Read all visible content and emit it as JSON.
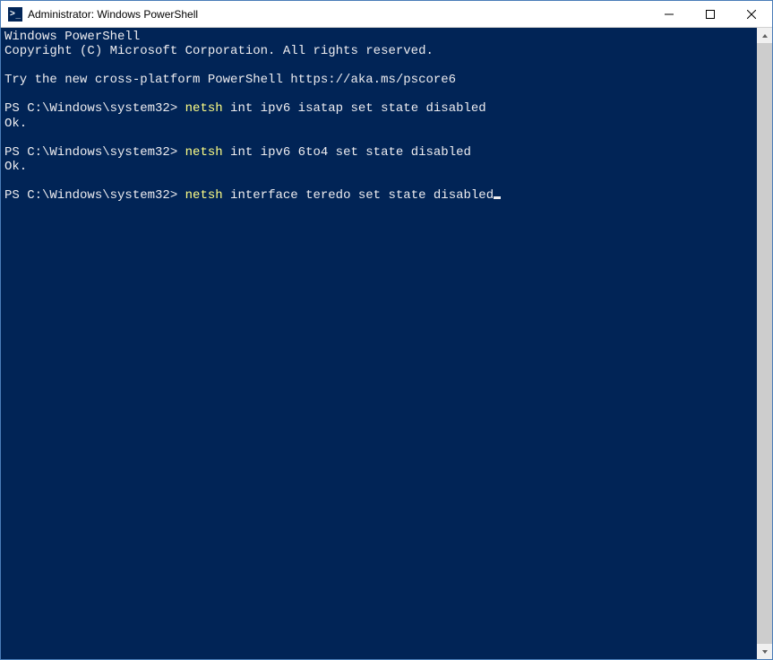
{
  "window": {
    "title": "Administrator: Windows PowerShell"
  },
  "terminal": {
    "header1": "Windows PowerShell",
    "header2": "Copyright (C) Microsoft Corporation. All rights reserved.",
    "try_msg": "Try the new cross-platform PowerShell https://aka.ms/pscore6",
    "prompt": "PS C:\\Windows\\system32> ",
    "ok": "Ok.",
    "cmd1_exe": "netsh",
    "cmd1_args": " int ipv6 isatap set state disabled",
    "cmd2_exe": "netsh",
    "cmd2_args": " int ipv6 6to4 set state disabled",
    "cmd3_exe": "netsh",
    "cmd3_args": " interface teredo set state disabled"
  }
}
